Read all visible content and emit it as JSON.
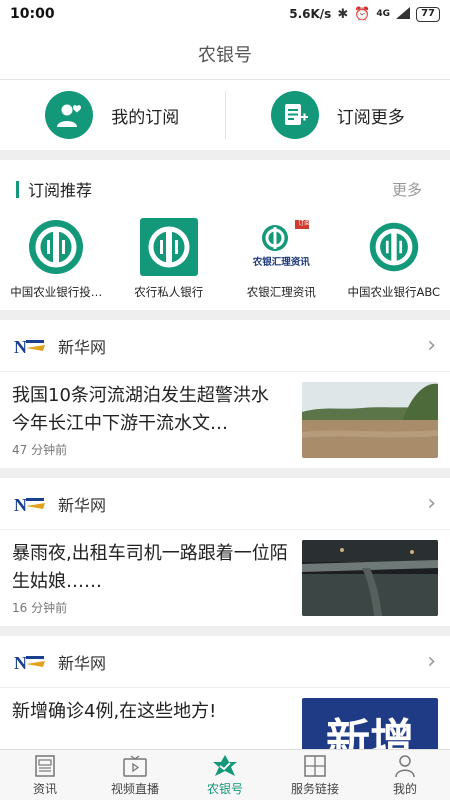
{
  "status_bar": {
    "time": "10:00",
    "speed": "5.6K/s",
    "network": "4G",
    "battery": "77"
  },
  "title": "农银号",
  "subscriptions": {
    "mine_label": "我的订阅",
    "more_label": "订阅更多"
  },
  "recommend": {
    "title": "订阅推荐",
    "more": "更多",
    "items": [
      {
        "name": "中国农业银行投…",
        "logo": "abc-icon"
      },
      {
        "name": "农行私人银行",
        "logo": "abc-square-icon"
      },
      {
        "name": "农银汇理资讯",
        "logo": "abc-news-icon",
        "logo_text": "农银汇理资讯",
        "badge": "订阅"
      },
      {
        "name": "中国农业银行ABC",
        "logo": "abc-icon"
      }
    ]
  },
  "feed": [
    {
      "source": "新华网",
      "title": "我国10条河流湖泊发生超警洪水 今年长江中下游干流水文…",
      "time": "47 分钟前",
      "thumb": "flood-river"
    },
    {
      "source": "新华网",
      "title": "暴雨夜,出租车司机一路跟着一位陌生姑娘……",
      "time": "16 分钟前",
      "thumb": "night-rain"
    },
    {
      "source": "新华网",
      "title": "新增确诊4例,在这些地方!",
      "time": "",
      "thumb": "xinzeng-text",
      "thumb_text": "新增"
    }
  ],
  "bottom_nav": [
    {
      "label": "资讯",
      "icon": "news-icon",
      "active": false
    },
    {
      "label": "视频直播",
      "icon": "tv-icon",
      "active": false
    },
    {
      "label": "农银号",
      "icon": "star-icon",
      "active": true
    },
    {
      "label": "服务链接",
      "icon": "grid-icon",
      "active": false
    },
    {
      "label": "我的",
      "icon": "person-icon",
      "active": false
    }
  ],
  "colors": {
    "accent": "#13987a",
    "background": "#efefef"
  }
}
